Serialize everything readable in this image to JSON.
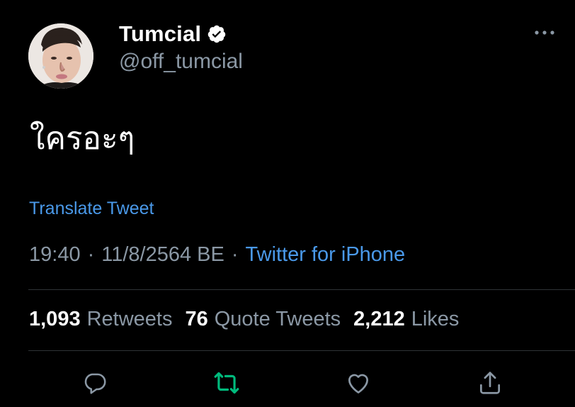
{
  "tweet": {
    "author": {
      "display_name": "Tumcial",
      "handle": "@off_tumcial",
      "verified": true
    },
    "text": "ใครอะๆ",
    "translate_label": "Translate Tweet",
    "time": "19:40",
    "date": "11/8/2564 BE",
    "separator": "·",
    "source": "Twitter for iPhone",
    "stats": {
      "retweets_count": "1,093",
      "retweets_label": "Retweets",
      "quotes_count": "76",
      "quotes_label": "Quote Tweets",
      "likes_count": "2,212",
      "likes_label": "Likes"
    }
  },
  "icons": {
    "more": "more-horizontal-icon",
    "verified": "verified-badge-icon",
    "reply": "reply-icon",
    "retweet": "retweet-icon",
    "like": "heart-icon",
    "share": "share-icon"
  },
  "colors": {
    "background": "#000000",
    "link_blue": "#4a99e9",
    "secondary_text": "#8b98a5",
    "retweet_green": "#00ba7c",
    "divider": "#2f3336"
  }
}
